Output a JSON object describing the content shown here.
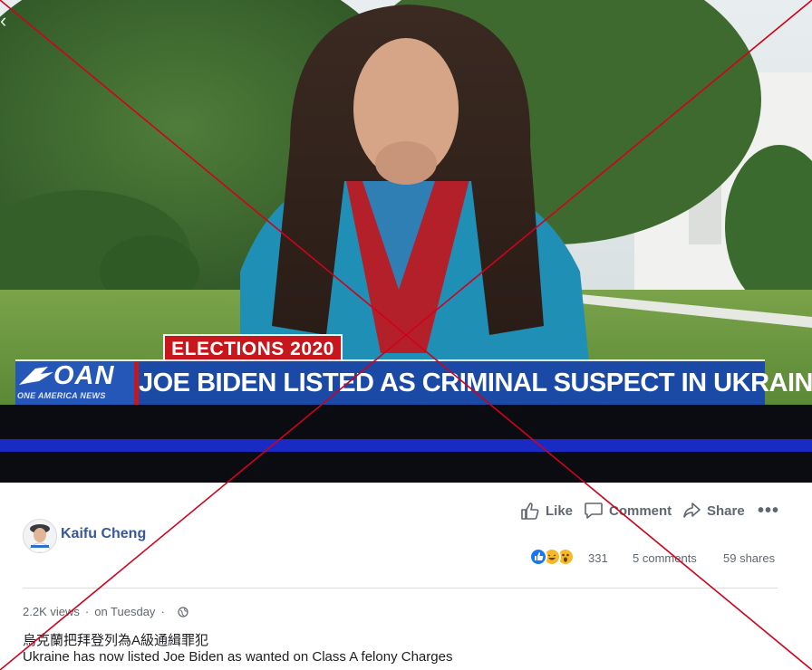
{
  "video": {
    "banner_top": "ELECTIONS 2020",
    "logo_text": "OAN",
    "logo_subtext": "ONE AMERICA NEWS",
    "headline": "JOE BIDEN LISTED AS CRIMINAL SUSPECT IN UKRAINIAN COURT"
  },
  "actions": {
    "like_label": "Like",
    "comment_label": "Comment",
    "share_label": "Share",
    "more_label": "•••"
  },
  "author": {
    "name": "Kaifu Cheng"
  },
  "stats": {
    "reactions": "331",
    "comments": "5 comments",
    "shares": "59 shares"
  },
  "meta": {
    "views": "2.2K views",
    "separator": "·",
    "date": "on Tuesday",
    "separator2": "·"
  },
  "caption": {
    "chinese": "烏克蘭把拜登列為A級通緝罪犯",
    "english": "Ukraine has now listed Joe Biden as wanted on Class A felony Charges"
  },
  "colors": {
    "link_blue": "#385898",
    "muted_gray": "#606770",
    "banner_blue": "#1b4aa6",
    "banner_red": "#c8161d",
    "overlay_red": "#d0021b"
  },
  "icons": [
    "close-icon",
    "like-icon",
    "comment-icon",
    "share-icon",
    "more-icon",
    "globe-icon",
    "like-reaction-icon",
    "haha-reaction-icon",
    "wow-reaction-icon"
  ]
}
